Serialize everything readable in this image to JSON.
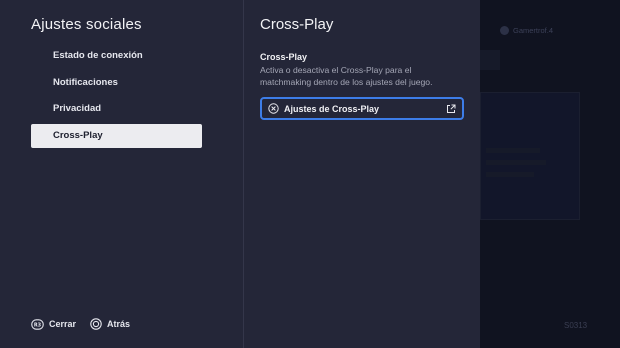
{
  "left": {
    "title": "Ajustes sociales",
    "menu": [
      {
        "label": "Estado de conexión",
        "selected": false
      },
      {
        "label": "Notificaciones",
        "selected": false
      },
      {
        "label": "Privacidad",
        "selected": false
      },
      {
        "label": "Cross-Play",
        "selected": true
      }
    ],
    "footer": {
      "close_label": "Cerrar",
      "close_icon": "r3-button-icon",
      "back_label": "Atrás",
      "back_icon": "circle-button-icon"
    }
  },
  "main": {
    "title": "Cross-Play",
    "section": {
      "title": "Cross-Play",
      "description": "Activa o desactiva el Cross-Play para el matchmaking dentro de los ajustes del juego.",
      "button_label": "Ajustes de Cross-Play",
      "button_icon": "cross-circle-icon",
      "button_trailing_icon": "external-link-icon"
    }
  },
  "background": {
    "user_label": "Gamertrof.4",
    "code": "S0313"
  },
  "colors": {
    "panel": "#242638",
    "selected_bg": "#ececf0",
    "focus_border": "#3d7de8",
    "muted_text": "#a5a7b6"
  }
}
